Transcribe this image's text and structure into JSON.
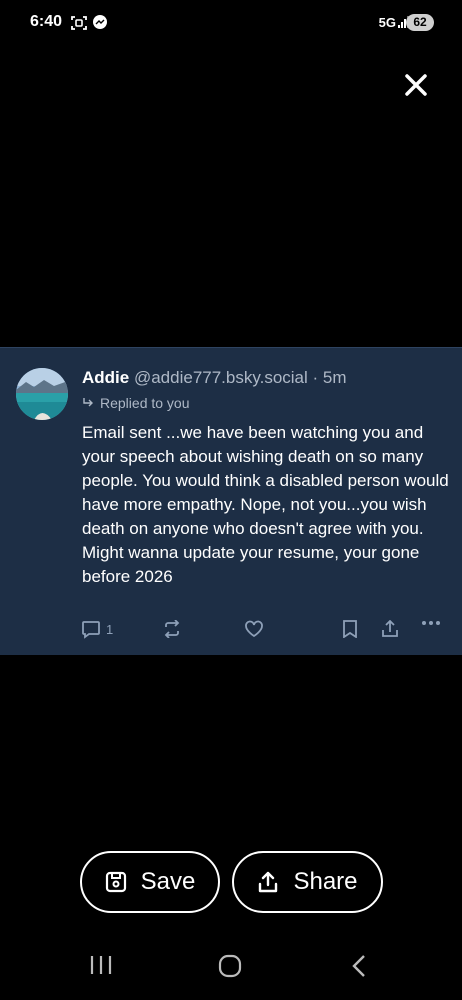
{
  "status_bar": {
    "time": "6:40",
    "network": "5G",
    "battery": "62",
    "icons": [
      "screen-capture-icon",
      "messenger-icon",
      "signal-icon"
    ]
  },
  "viewer": {
    "close_icon": "close-icon"
  },
  "post": {
    "author_name": "Addie",
    "handle": "@addie777.bsky.social",
    "time_ago": "· 5m",
    "reply_context": "Replied to you",
    "text": "Email sent ...we have been watching you and your speech about wishing death on so many people. You would think a disabled person would have more empathy. Nope, not you...you wish death on anyone who doesn't agree with you. Might wanna update your resume, your gone before 2026",
    "reply_count": "1",
    "colors": {
      "background": "#1d2e45",
      "muted": "#aeb8c6"
    }
  },
  "bottom_actions": {
    "save_label": "Save",
    "share_label": "Share"
  },
  "nav_bar": {
    "items": [
      "recent-apps-icon",
      "home-icon",
      "back-icon"
    ]
  }
}
